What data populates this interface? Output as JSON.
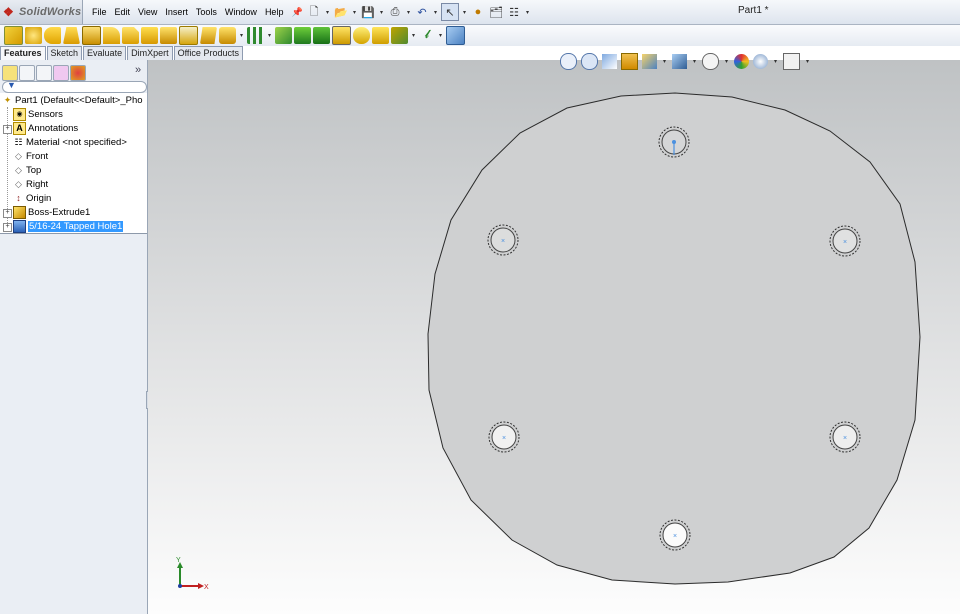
{
  "app": {
    "name": "SolidWorks",
    "document_title": "Part1 *"
  },
  "menu": [
    "File",
    "Edit",
    "View",
    "Insert",
    "Tools",
    "Window",
    "Help"
  ],
  "tabs": [
    "Features",
    "Sketch",
    "Evaluate",
    "DimXpert",
    "Office Products"
  ],
  "tree": {
    "root": "Part1  (Default<<Default>_Pho",
    "items": [
      "Sensors",
      "Annotations",
      "Material <not specified>",
      "Front",
      "Top",
      "Right",
      "Origin",
      "Boss-Extrude1",
      "5/16-24 Tapped Hole1"
    ],
    "selected": "5/16-24 Tapped Hole1"
  },
  "triad": {
    "x": "X",
    "y": "Y"
  },
  "colors": {
    "selection": "#3399ff",
    "hole_center": "#4a90e0",
    "part_face": "#cfd0d1"
  }
}
